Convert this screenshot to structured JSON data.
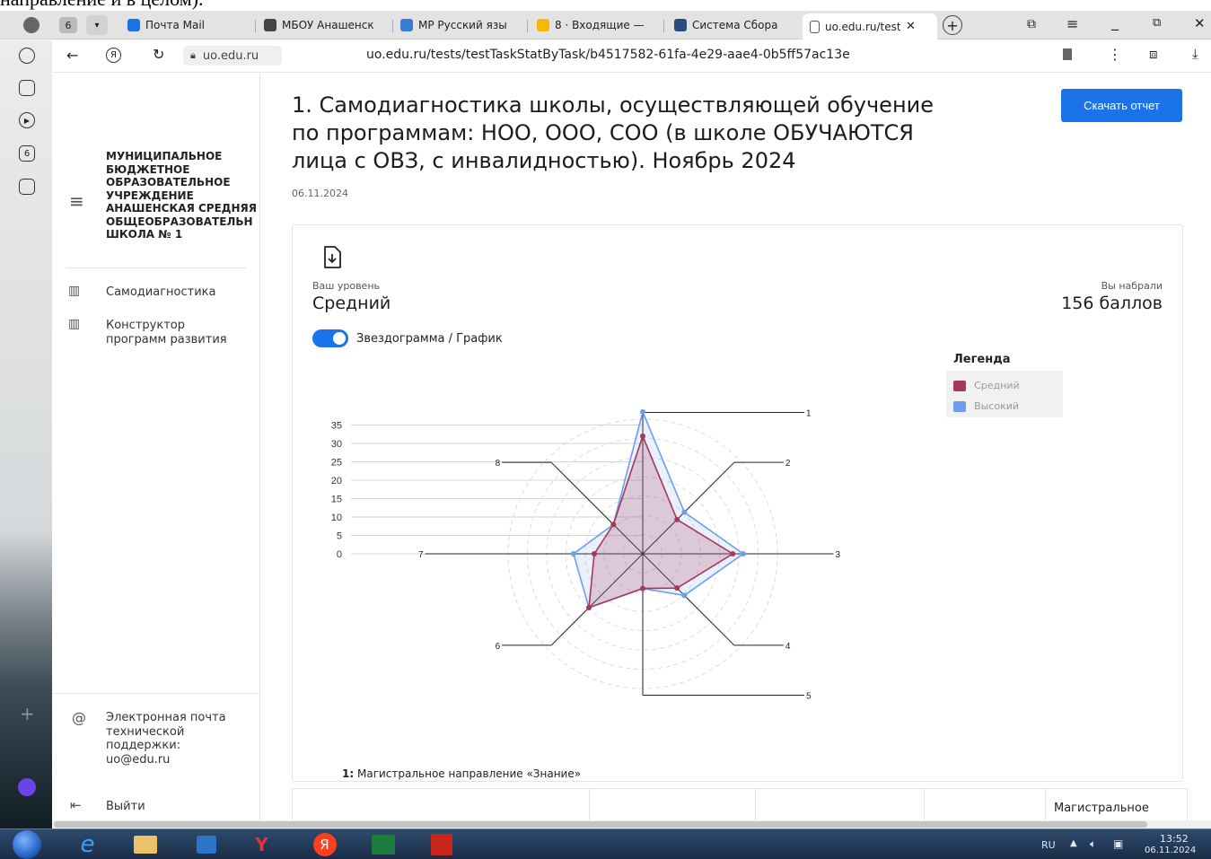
{
  "top_cut_text": "направление и в целом).",
  "browser": {
    "tab_count_badge": "6",
    "tabs": [
      "Почта Mail",
      "МБОУ Анашенск",
      "МР Русский язы",
      "8 · Входящие —",
      "Система Сбора",
      "uo.edu.ru/test"
    ],
    "address_domain": "uo.edu.ru",
    "address_url": "uo.edu.ru/tests/testTaskStatByTask/b4517582-61fa-4e29-aae4-0b5ff57ac13e",
    "side_badge": "6"
  },
  "sidebar": {
    "org_name": [
      "МУНИЦИПАЛЬНОЕ",
      "БЮДЖЕТНОЕ",
      "ОБРАЗОВАТЕЛЬНОЕ",
      "УЧРЕЖДЕНИЕ",
      "АНАШЕНСКАЯ СРЕДНЯЯ",
      "ОБЩЕОБРАЗОВАТЕЛЬН",
      "ШКОЛА № 1"
    ],
    "nav": [
      "Самодиагностика",
      "Конструктор программ развития"
    ],
    "support": [
      "Электронная почта",
      "технической",
      "поддержки:",
      "uo@edu.ru"
    ],
    "logout": "Выйти"
  },
  "page": {
    "title": [
      "1. Самодиагностика школы, осуществляющей обучение",
      "по программам: НОО, ООО, СОО (в школе ОБУЧАЮТСЯ",
      "лица с ОВЗ, с инвалидностью). Ноябрь 2024"
    ],
    "date": "06.11.2024",
    "download_button": "Скачать отчет",
    "level_label": "Ваш уровень",
    "level_value": "Средний",
    "score_label": "Вы набрали",
    "score_value": "156 баллов",
    "toggle_label": "Звездограмма / График",
    "toggle_on": true,
    "criterion_num": "1:",
    "criterion_text": "Магистральное направление «Знание»",
    "table_header_last": "Магистральное"
  },
  "colors": {
    "accent": "#1a73e8",
    "series_medium": "#a8365a",
    "series_high": "#6d9eeb"
  },
  "chart_data": {
    "type": "radar",
    "axes": [
      "1",
      "2",
      "3",
      "4",
      "5",
      "6",
      "7",
      "8"
    ],
    "r_ticks": [
      0,
      5,
      10,
      15,
      20,
      25,
      30,
      35
    ],
    "rlim": [
      0,
      35
    ],
    "grid": true,
    "legend": {
      "title": "Легенда",
      "position": "top-right"
    },
    "series": [
      {
        "name": "Средний",
        "values": [
          34,
          14,
          26,
          14,
          10,
          22,
          14,
          12
        ]
      },
      {
        "name": "Высокий",
        "values": [
          41,
          17,
          29,
          17,
          10,
          22,
          20,
          12
        ]
      }
    ]
  },
  "taskbar": {
    "lang": "RU",
    "time": "13:52",
    "date": "06.11.2024"
  }
}
